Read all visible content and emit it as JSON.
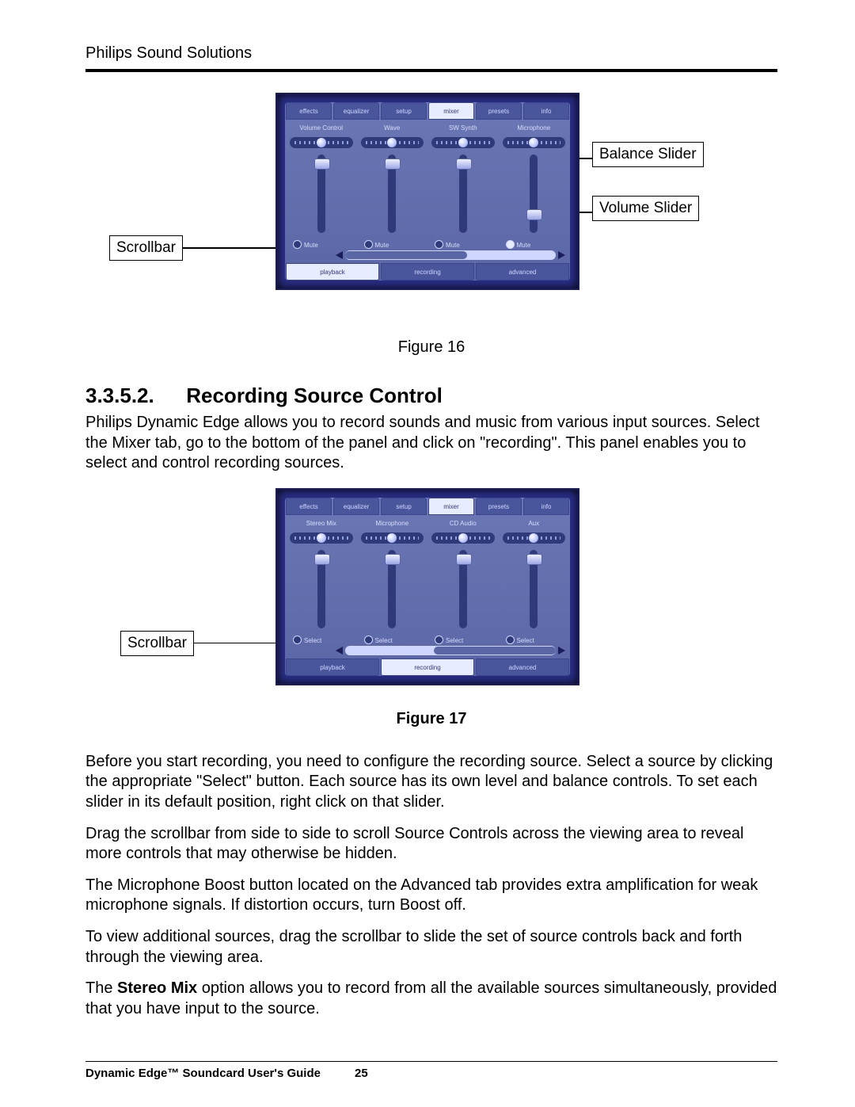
{
  "header": {
    "running_head": "Philips Sound Solutions"
  },
  "footer": {
    "title": "Dynamic Edge™ Soundcard User's Guide",
    "page": "25"
  },
  "figure16": {
    "caption": "Figure 16",
    "callouts": {
      "scrollbar": "Scrollbar",
      "balance_slider": "Balance Slider",
      "volume_slider": "Volume Slider"
    },
    "panel": {
      "top_tabs": [
        "effects",
        "equalizer",
        "setup",
        "mixer",
        "presets",
        "info"
      ],
      "active_top_index": 3,
      "bottom_tabs": [
        "playback",
        "recording",
        "advanced"
      ],
      "active_bottom_index": 0,
      "channels": [
        {
          "name": "Volume Control",
          "mute_label": "Mute",
          "vpos": 5,
          "selected": false
        },
        {
          "name": "Wave",
          "mute_label": "Mute",
          "vpos": 5,
          "selected": false
        },
        {
          "name": "SW Synth",
          "mute_label": "Mute",
          "vpos": 5,
          "selected": false
        },
        {
          "name": "Microphone",
          "mute_label": "Mute",
          "vpos": 70,
          "selected": true
        }
      ],
      "scroll": {
        "thumb_left_pct": 0,
        "thumb_width_pct": 58
      }
    }
  },
  "section": {
    "number": "3.3.5.2.",
    "title": "Recording Source Control",
    "intro": "Philips Dynamic Edge allows you to record sounds and music from various input sources. Select the Mixer tab, go to the bottom of the panel and click on \"recording\". This panel enables you to select and control recording sources.",
    "p1": "Before you start recording, you need to configure the recording source. Select a source by clicking the appropriate \"Select\" button. Each source has its own level and balance controls. To set each slider in its default position, right click on that slider.",
    "p2": "Drag the scrollbar from side to side to scroll Source Controls across the viewing area to reveal more controls that may otherwise be hidden.",
    "p3": "The Microphone Boost button located on the Advanced tab provides extra amplification for weak microphone signals. If distortion occurs, turn Boost off.",
    "p4": "To view additional sources, drag the scrollbar to slide the set of source controls back and forth through the viewing area.",
    "p5_pre": "The ",
    "p5_bold": "Stereo Mix",
    "p5_post": " option allows you to record from all the available sources simultaneously, provided that you have input to the source."
  },
  "figure17": {
    "caption": "Figure 17",
    "callouts": {
      "scrollbar": "Scrollbar"
    },
    "panel": {
      "top_tabs": [
        "effects",
        "equalizer",
        "setup",
        "mixer",
        "presets",
        "info"
      ],
      "active_top_index": 3,
      "bottom_tabs": [
        "playback",
        "recording",
        "advanced"
      ],
      "active_bottom_index": 1,
      "channels": [
        {
          "name": "Stereo Mix",
          "mute_label": "Select",
          "vpos": 5,
          "selected": false
        },
        {
          "name": "Microphone",
          "mute_label": "Select",
          "vpos": 5,
          "selected": false
        },
        {
          "name": "CD Audio",
          "mute_label": "Select",
          "vpos": 5,
          "selected": false
        },
        {
          "name": "Aux",
          "mute_label": "Select",
          "vpos": 5,
          "selected": false
        }
      ],
      "scroll": {
        "thumb_left_pct": 42,
        "thumb_width_pct": 58
      }
    }
  }
}
